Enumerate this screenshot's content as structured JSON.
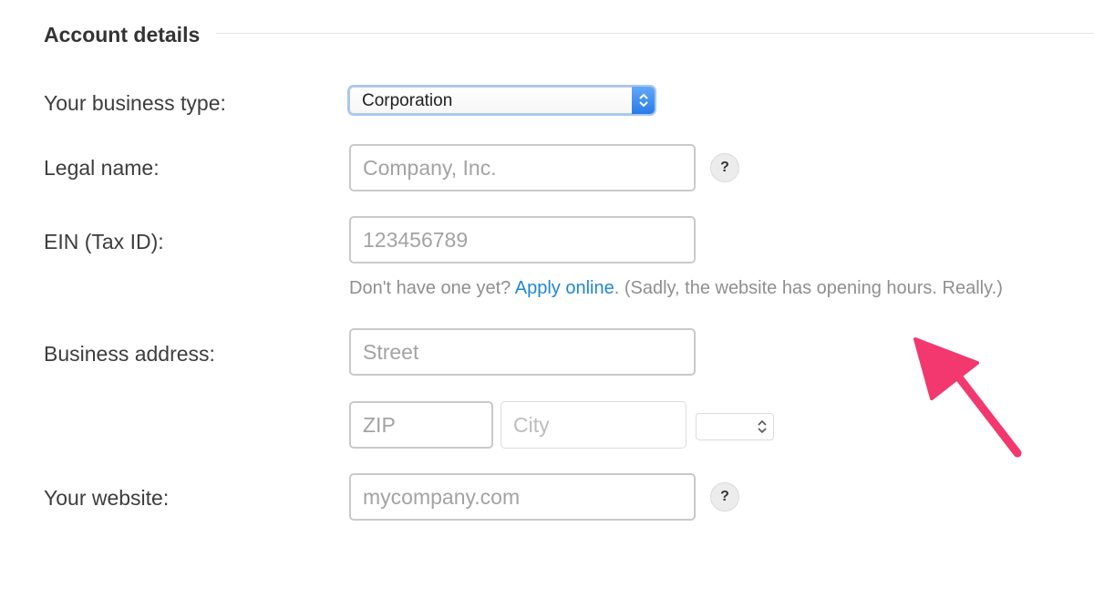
{
  "section": {
    "title": "Account details"
  },
  "form": {
    "business_type": {
      "label": "Your business type:",
      "value": "Corporation"
    },
    "legal_name": {
      "label": "Legal name:",
      "placeholder": "Company, Inc.",
      "help": "?"
    },
    "ein": {
      "label": "EIN (Tax ID):",
      "placeholder": "123456789",
      "hint_before": "Don't have one yet? ",
      "hint_link": "Apply online",
      "hint_after": ". (Sadly, the website has opening hours. Really.)"
    },
    "address": {
      "label": "Business address:",
      "street_placeholder": "Street",
      "zip_placeholder": "ZIP",
      "city_placeholder": "City",
      "state_value": ""
    },
    "website": {
      "label": "Your website:",
      "placeholder": "mycompany.com",
      "help": "?"
    }
  },
  "icons": {
    "select_arrows": "up-down-chevron-icon",
    "help": "question-mark-icon",
    "annotation": "arrow-icon"
  },
  "colors": {
    "link": "#1f86d9",
    "select_accent": "#2a7be8",
    "annotation_arrow": "#f2386e"
  }
}
